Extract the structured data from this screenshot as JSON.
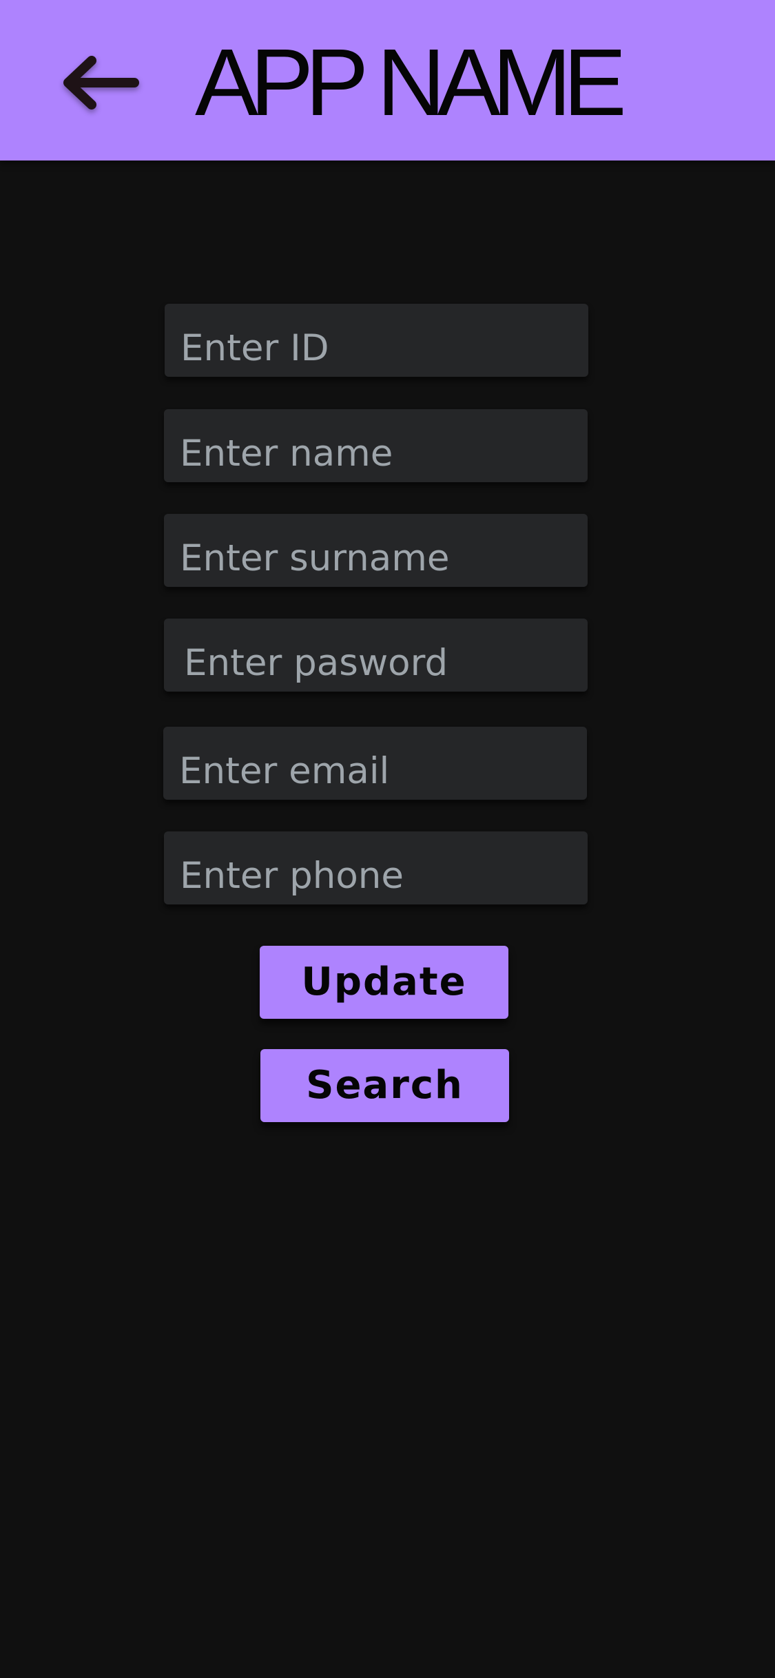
{
  "header": {
    "title": "APP NAME",
    "back_icon": "arrow-left-icon",
    "background_color": "#ae83fe"
  },
  "form": {
    "id_placeholder": "Enter ID",
    "name_placeholder": "Enter name",
    "surname_placeholder": "Enter surname",
    "password_placeholder": "Enter pasword",
    "email_placeholder": "Enter email",
    "phone_placeholder": "Enter phone"
  },
  "actions": {
    "update_label": "Update",
    "search_label": "Search",
    "button_color": "#ae83fe"
  },
  "theme": {
    "background": "#101010",
    "field_background": "#252628",
    "placeholder_color": "#9ea5ab"
  }
}
